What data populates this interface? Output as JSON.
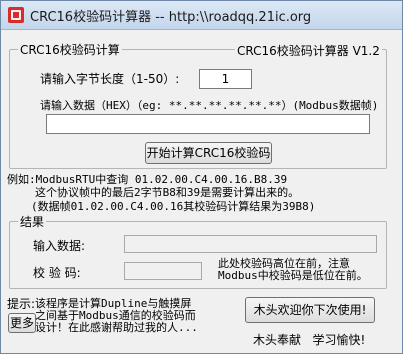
{
  "window": {
    "title": "CRC16校验码计算器 -- http:\\\\roadqq.21ic.org"
  },
  "calc_group": {
    "label": "CRC16校验码计算",
    "version": "CRC16校验码计算器 V1.2",
    "length_label": "请输入字节长度（1-50）:",
    "length_value": "1",
    "data_label": "请输入数据（HEX）（eg: **.**.**.**.**.**）(Modbus数据帧)",
    "data_value": "",
    "start_button": "开始计算CRC16校验码"
  },
  "example": {
    "line1": "例如:ModbusRTU中查询 01.02.00.C4.00.16.B8.39",
    "line2": "这个协议帧中的最后2字节B8和39是需要计算出来的。",
    "line3": "(数据帧01.02.00.C4.00.16其校验码计算结果为39B8)"
  },
  "result_group": {
    "label": "结果",
    "input_data_label": "输入数据:",
    "input_data_value": "",
    "check_code_label": "校 验 码:",
    "check_code_value": "",
    "note_line1": "此处校验码高位在前，注意",
    "note_line2": "Modbus中校验码是低位在前。"
  },
  "footer": {
    "tip_label": "提示:",
    "tip_line1": "该程序是计算Dupline与触摸屏",
    "tip_line2": "之间基于Modbus通信的校验码而",
    "tip_line3": "设计！在此感谢帮助过我的人...",
    "more_button": "更多",
    "welcome_button": "木头欢迎你下次使用!",
    "signature": "木头奉献   学习愉快!"
  }
}
